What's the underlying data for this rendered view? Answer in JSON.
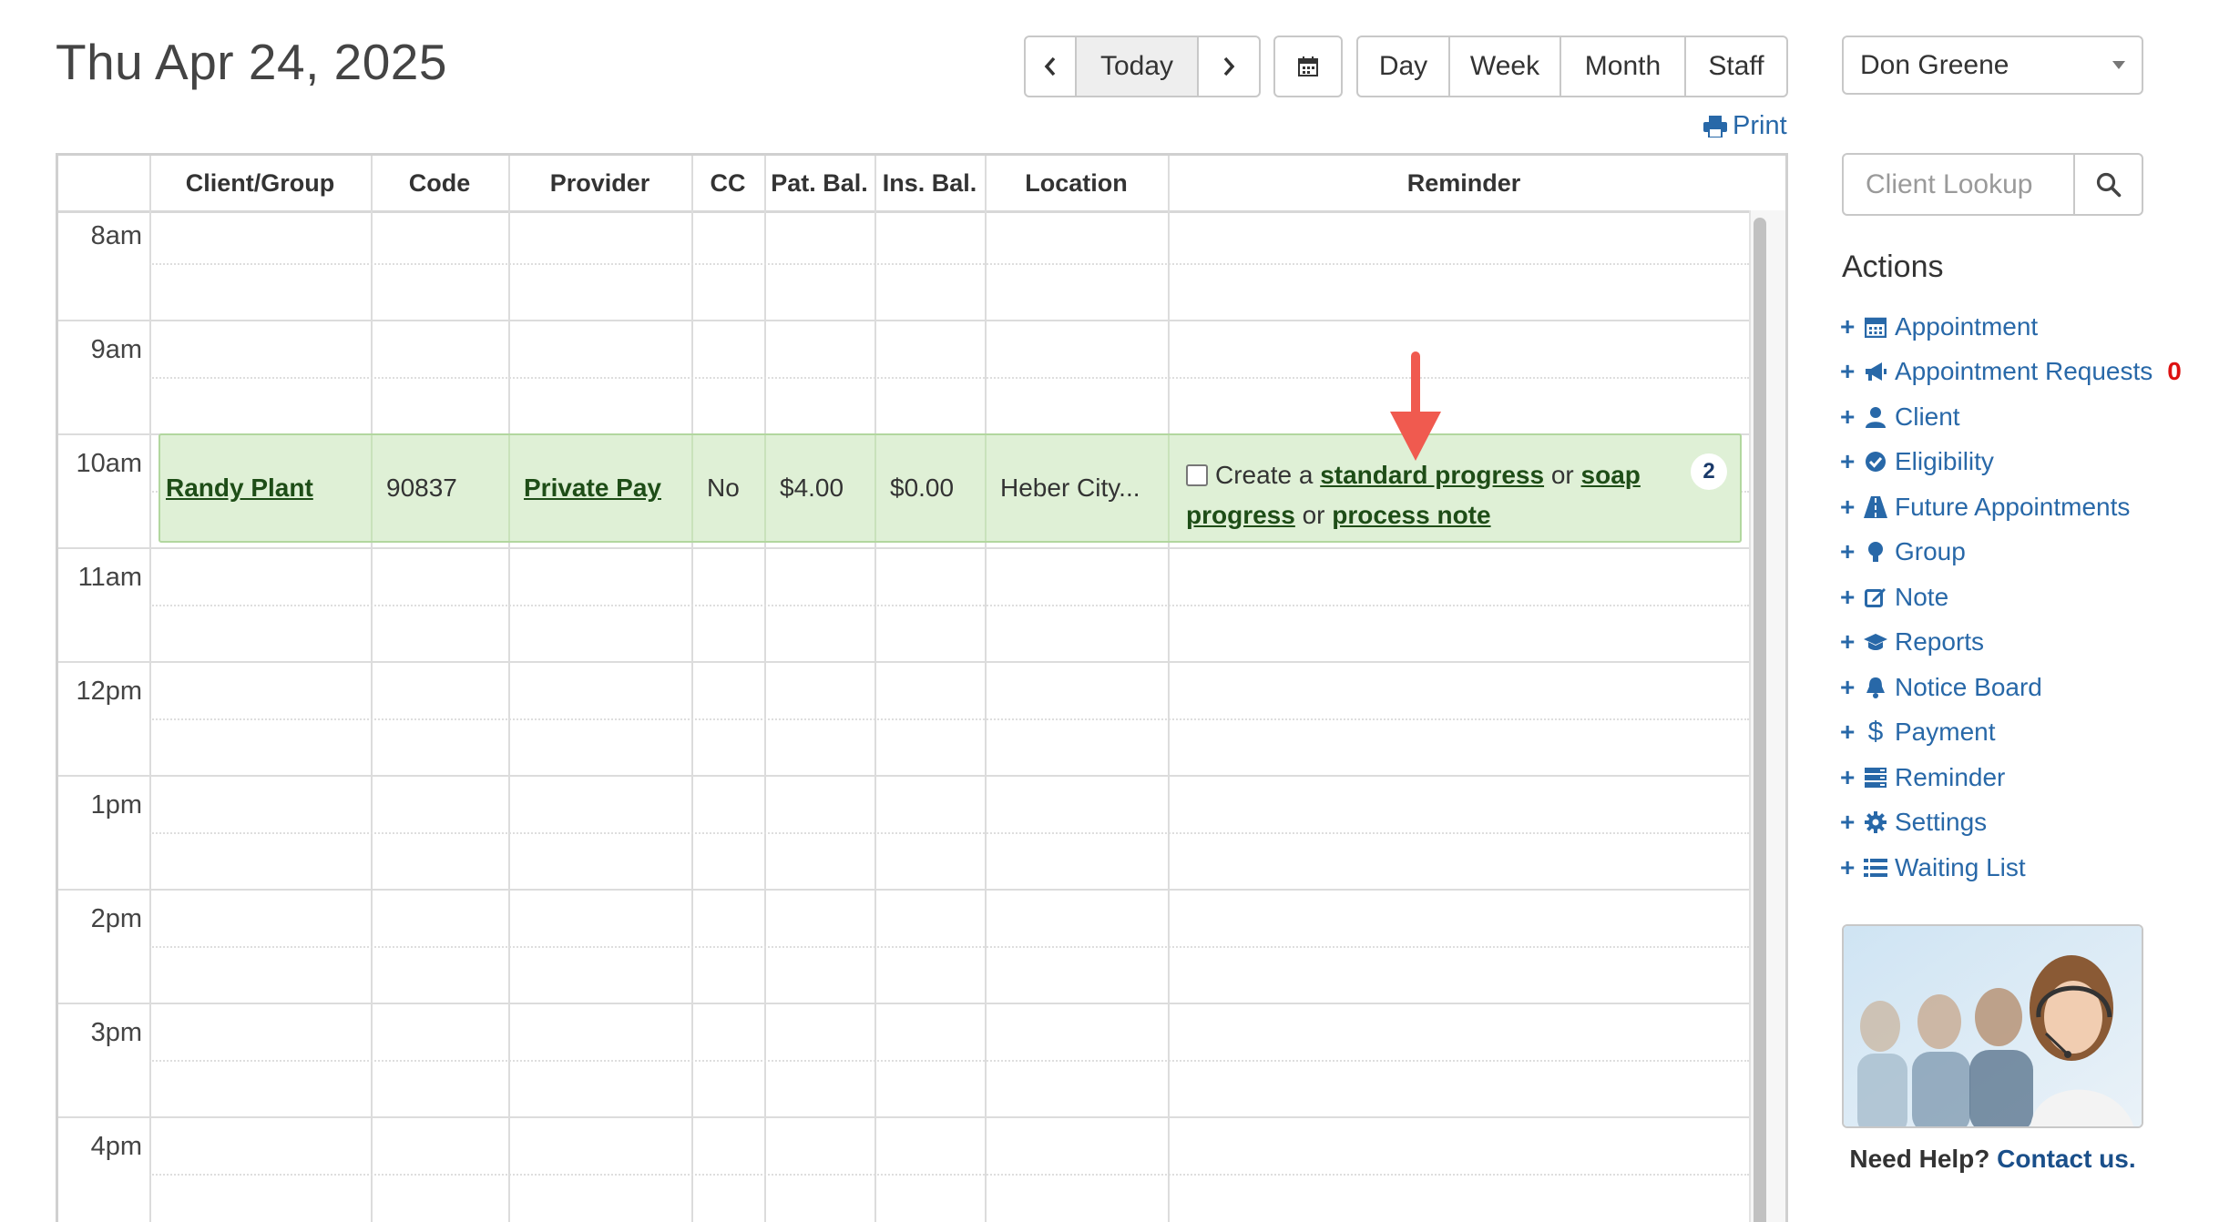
{
  "header": {
    "date_title": "Thu Apr 24, 2025",
    "today_label": "Today",
    "views": [
      "Day",
      "Week",
      "Month",
      "Staff"
    ],
    "print_label": "Print"
  },
  "staff_select": {
    "value": "Don Greene"
  },
  "lookup": {
    "placeholder": "Client Lookup"
  },
  "actions": {
    "title": "Actions",
    "items": [
      {
        "label": "Appointment",
        "icon": "calendar-icon"
      },
      {
        "label": "Appointment Requests",
        "icon": "megaphone-icon",
        "badge": "0"
      },
      {
        "label": "Client",
        "icon": "user-icon"
      },
      {
        "label": "Eligibility",
        "icon": "check-circle-icon"
      },
      {
        "label": "Future Appointments",
        "icon": "road-icon"
      },
      {
        "label": "Group",
        "icon": "group-icon"
      },
      {
        "label": "Note",
        "icon": "edit-icon"
      },
      {
        "label": "Reports",
        "icon": "graduation-cap-icon"
      },
      {
        "label": "Notice Board",
        "icon": "bell-icon"
      },
      {
        "label": "Payment",
        "icon": "dollar-icon"
      },
      {
        "label": "Reminder",
        "icon": "tasks-icon"
      },
      {
        "label": "Settings",
        "icon": "gear-icon"
      },
      {
        "label": "Waiting List",
        "icon": "list-icon"
      }
    ]
  },
  "help": {
    "prefix": "Need Help?",
    "link": "Contact us."
  },
  "grid": {
    "columns": [
      "Client/Group",
      "Code",
      "Provider",
      "CC",
      "Pat. Bal.",
      "Ins. Bal.",
      "Location",
      "Reminder"
    ],
    "hours": [
      "8am",
      "9am",
      "10am",
      "11am",
      "12pm",
      "1pm",
      "2pm",
      "3pm",
      "4pm"
    ]
  },
  "appointment": {
    "client": "Randy Plant",
    "code": "90837",
    "provider": "Private Pay",
    "cc": "No",
    "pat_bal": "$4.00",
    "ins_bal": "$0.00",
    "location": "Heber City...",
    "reminder": {
      "prefix": "Create a",
      "link1": "standard progress",
      "or1": "or",
      "link2": "soap progress",
      "or2": "or",
      "link3": "process note"
    },
    "count": "2"
  },
  "colors": {
    "link": "#2868a8",
    "appointment_bg": "#dff0d6",
    "arrow": "#f05a4f",
    "badge": "#dd1111"
  }
}
